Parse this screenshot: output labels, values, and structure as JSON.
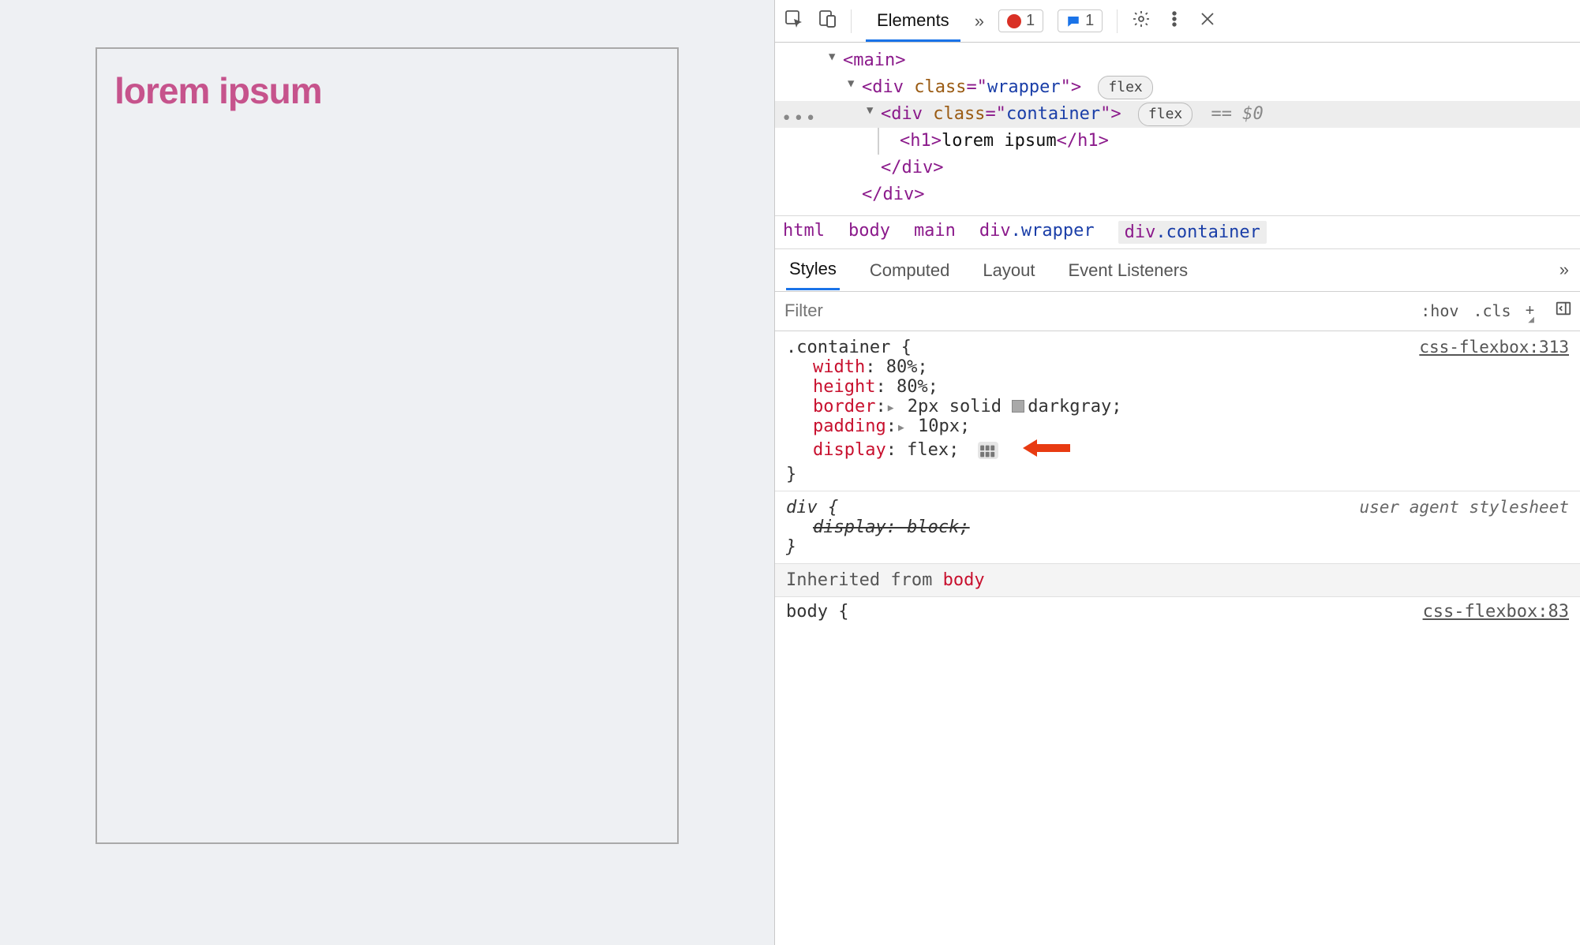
{
  "page": {
    "heading": "lorem ipsum"
  },
  "toolbar": {
    "tabs": {
      "elements": "Elements"
    },
    "more_tabs_glyph": "»",
    "errors_count": "1",
    "messages_count": "1"
  },
  "dom": {
    "main_open": "<main>",
    "wrapper_open_pre": "<div ",
    "wrapper_attr_name": "class",
    "wrapper_attr_eq": "=\"",
    "wrapper_attr_val": "wrapper",
    "wrapper_open_post": "\">",
    "container_open_pre": "<div ",
    "container_attr_name": "class",
    "container_attr_eq": "=\"",
    "container_attr_val": "container",
    "container_open_post": "\">",
    "h1_open": "<h1>",
    "h1_text": "lorem ipsum",
    "h1_close": "</h1>",
    "div_close_1": "</div>",
    "div_close_2": "</div>",
    "flex_pill": "flex",
    "sel_suffix": "== $0"
  },
  "crumbs": {
    "c0": "html",
    "c1": "body",
    "c2": "main",
    "c3_el": "div",
    "c3_cls": ".wrapper",
    "c4_el": "div",
    "c4_cls": ".container"
  },
  "subtabs": {
    "styles": "Styles",
    "computed": "Computed",
    "layout": "Layout",
    "events": "Event Listeners",
    "more": "»"
  },
  "filter": {
    "placeholder": "Filter",
    "hov": ":hov",
    "cls": ".cls",
    "plus": "+"
  },
  "rules": {
    "r1": {
      "selector": ".container {",
      "source": "css-flexbox:313",
      "p_width_n": "width",
      "p_width_v": ": 80%;",
      "p_height_n": "height",
      "p_height_v": ": 80%;",
      "p_border_n": "border",
      "p_border_v_pre": ":",
      "p_border_v_mid": " 2px solid ",
      "p_border_v_color": "darkgray;",
      "p_padding_n": "padding",
      "p_padding_v_pre": ":",
      "p_padding_v": " 10px;",
      "p_display_n": "display",
      "p_display_v": ": flex;",
      "close": "}"
    },
    "r2": {
      "selector": "div {",
      "source": "user agent stylesheet",
      "decl": "display: block;",
      "close": "}"
    },
    "inherited_label": "Inherited from ",
    "inherited_from": "body",
    "peek_sel": "body {",
    "peek_src": "css-flexbox:83"
  }
}
